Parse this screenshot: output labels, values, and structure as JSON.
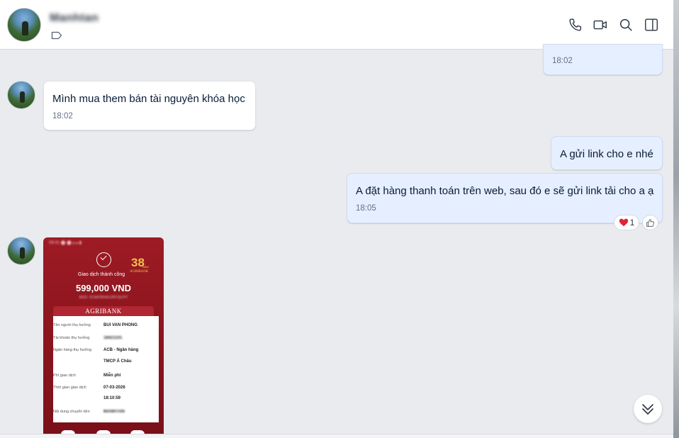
{
  "header": {
    "contact_name": "Manhtan"
  },
  "messages": [
    {
      "direction": "out",
      "text": "",
      "time": "18:02"
    },
    {
      "direction": "in",
      "text": "Mình mua them bán tài nguyên khóa học",
      "time": "18:02"
    },
    {
      "direction": "out",
      "text": "A gửi link cho e nhé",
      "time": ""
    },
    {
      "direction": "out",
      "text": "A đặt hàng thanh toán trên web, sau đó e sẽ gửi link tải cho a ạ",
      "time": "18:05"
    }
  ],
  "reaction": {
    "emoji": "heart",
    "count": "1"
  },
  "receipt": {
    "status_bar": "09:41 ⬤ ⬤   ▴ ▴ ▮",
    "anniversary_number": "38",
    "anniversary_unit": "NĂM",
    "anniversary_brand": "AGRIBANK",
    "success_text": "Giao dịch thành công",
    "amount": "599,000 VND",
    "code": "MGD: 3CAAYBHAXJRFQILPIT",
    "bank_name": "AGRIBANK",
    "rows": [
      {
        "key": "Tên người thụ hưởng",
        "value": "BUI VAN PHONG"
      },
      {
        "key": "Tài khoản thụ hưởng",
        "value": "18421101"
      },
      {
        "key": "Ngân hàng thụ hưởng",
        "value": "ACB - Ngân hàng"
      },
      {
        "key": "",
        "value": "TMCP Á Châu"
      },
      {
        "key": "Phí giao dịch",
        "value": "Miễn phí"
      },
      {
        "key": "Thời gian giao dịch",
        "value": "07-03-2026"
      },
      {
        "key": "",
        "value": "18:10:59"
      },
      {
        "key": "Nội dung chuyển tiền",
        "value": "MANHTAN"
      }
    ]
  },
  "colors": {
    "outgoing_bubble": "#e5efff",
    "incoming_bubble": "#ffffff",
    "chat_background": "#e9ebee",
    "receipt_red": "#9e1b25",
    "heart": "#e0243a"
  },
  "icons": [
    "phone-icon",
    "video-call-icon",
    "search-icon",
    "sidebar-toggle-icon",
    "tag-icon",
    "thumbs-up-icon",
    "double-chevron-down-icon"
  ]
}
